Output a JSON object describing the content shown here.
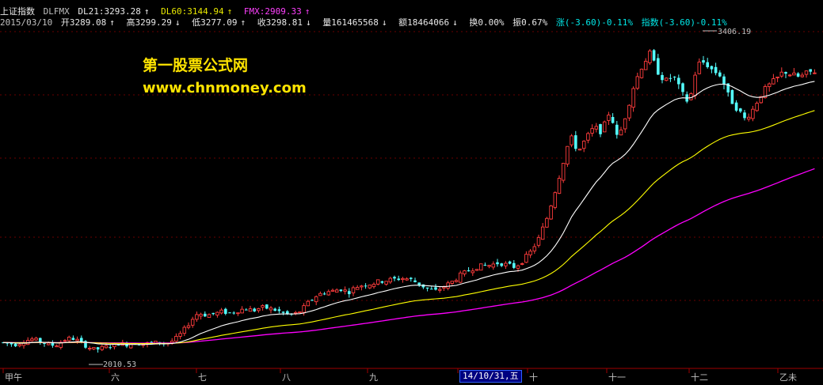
{
  "header": {
    "index_name": "上证指数",
    "indicator": "DLFMX",
    "dl21": "DL21:3293.28",
    "dl21_arrow": "↑",
    "dl60": "DL60:3144.94",
    "dl60_arrow": "↑",
    "fmx": "FMX:2909.33",
    "fmx_arrow": "↑"
  },
  "quote": {
    "date": "2015/03/10",
    "open": "开3289.08",
    "open_arrow": "↑",
    "high": "高3299.29",
    "high_arrow": "↓",
    "low": "低3277.09",
    "low_arrow": "↑",
    "close": "收3298.81",
    "close_arrow": "↓",
    "volume": "量161465568",
    "volume_arrow": "↓",
    "amount": "额18464066",
    "amount_arrow": "↓",
    "turnover": "换0.00%",
    "amplitude": "振0.67%",
    "change": "涨(-3.60)-0.11%",
    "index_change": "指数(-3.60)-0.11%"
  },
  "watermark": {
    "line1": "第一股票公式网",
    "line2": "www.chnmoney.com"
  },
  "chart_data": {
    "type": "candlestick",
    "annotations": {
      "high_label": "3406.19",
      "low_label": "2010.53"
    },
    "x_axis_labels": [
      "甲午",
      "六",
      "七",
      "八",
      "九",
      "十",
      "十一",
      "十二",
      "乙未"
    ],
    "cursor_date": "14/10/31,五",
    "ylim": [
      1950,
      3480
    ],
    "series": [
      {
        "name": "DL21",
        "color": "#ffffff"
      },
      {
        "name": "DL60",
        "color": "#ffff00"
      },
      {
        "name": "FMX",
        "color": "#ff00ff"
      }
    ],
    "close_path": [
      [
        0,
        2055
      ],
      [
        10,
        2050
      ],
      [
        20,
        2045
      ],
      [
        30,
        2060
      ],
      [
        40,
        2070
      ],
      [
        50,
        2060
      ],
      [
        60,
        2045
      ],
      [
        70,
        2040
      ],
      [
        80,
        2065
      ],
      [
        90,
        2075
      ],
      [
        100,
        2060
      ],
      [
        110,
        2035
      ],
      [
        120,
        2020
      ],
      [
        130,
        2030
      ],
      [
        140,
        2040
      ],
      [
        150,
        2050
      ],
      [
        160,
        2045
      ],
      [
        170,
        2052
      ],
      [
        180,
        2048
      ],
      [
        190,
        2050
      ],
      [
        200,
        2055
      ],
      [
        210,
        2050
      ],
      [
        220,
        2065
      ],
      [
        230,
        2100
      ],
      [
        240,
        2150
      ],
      [
        250,
        2190
      ],
      [
        260,
        2180
      ],
      [
        270,
        2185
      ],
      [
        280,
        2195
      ],
      [
        290,
        2190
      ],
      [
        300,
        2200
      ],
      [
        310,
        2210
      ],
      [
        320,
        2200
      ],
      [
        330,
        2215
      ],
      [
        340,
        2210
      ],
      [
        350,
        2200
      ],
      [
        360,
        2185
      ],
      [
        370,
        2180
      ],
      [
        380,
        2200
      ],
      [
        390,
        2240
      ],
      [
        400,
        2270
      ],
      [
        410,
        2285
      ],
      [
        420,
        2290
      ],
      [
        430,
        2300
      ],
      [
        440,
        2285
      ],
      [
        450,
        2310
      ],
      [
        460,
        2320
      ],
      [
        470,
        2325
      ],
      [
        480,
        2335
      ],
      [
        490,
        2340
      ],
      [
        500,
        2345
      ],
      [
        510,
        2350
      ],
      [
        520,
        2340
      ],
      [
        530,
        2320
      ],
      [
        540,
        2300
      ],
      [
        550,
        2290
      ],
      [
        560,
        2310
      ],
      [
        570,
        2330
      ],
      [
        580,
        2360
      ],
      [
        590,
        2380
      ],
      [
        600,
        2400
      ],
      [
        610,
        2405
      ],
      [
        620,
        2410
      ],
      [
        630,
        2420
      ],
      [
        640,
        2410
      ],
      [
        650,
        2400
      ],
      [
        660,
        2430
      ],
      [
        670,
        2470
      ],
      [
        680,
        2530
      ],
      [
        690,
        2620
      ],
      [
        700,
        2740
      ],
      [
        710,
        2870
      ],
      [
        720,
        3000
      ],
      [
        730,
        2930
      ],
      [
        740,
        2990
      ],
      [
        750,
        3040
      ],
      [
        760,
        3020
      ],
      [
        770,
        3120
      ],
      [
        780,
        2980
      ],
      [
        790,
        3100
      ],
      [
        800,
        3230
      ],
      [
        810,
        3320
      ],
      [
        820,
        3380
      ],
      [
        830,
        3300
      ],
      [
        840,
        3250
      ],
      [
        850,
        3280
      ],
      [
        860,
        3200
      ],
      [
        870,
        3150
      ],
      [
        880,
        3330
      ],
      [
        890,
        3340
      ],
      [
        900,
        3300
      ],
      [
        910,
        3280
      ],
      [
        920,
        3180
      ],
      [
        930,
        3130
      ],
      [
        940,
        3080
      ],
      [
        950,
        3120
      ],
      [
        960,
        3190
      ],
      [
        970,
        3230
      ],
      [
        980,
        3260
      ],
      [
        990,
        3300
      ],
      [
        1000,
        3280
      ],
      [
        1010,
        3270
      ],
      [
        1020,
        3290
      ],
      [
        1030,
        3300
      ]
    ]
  }
}
